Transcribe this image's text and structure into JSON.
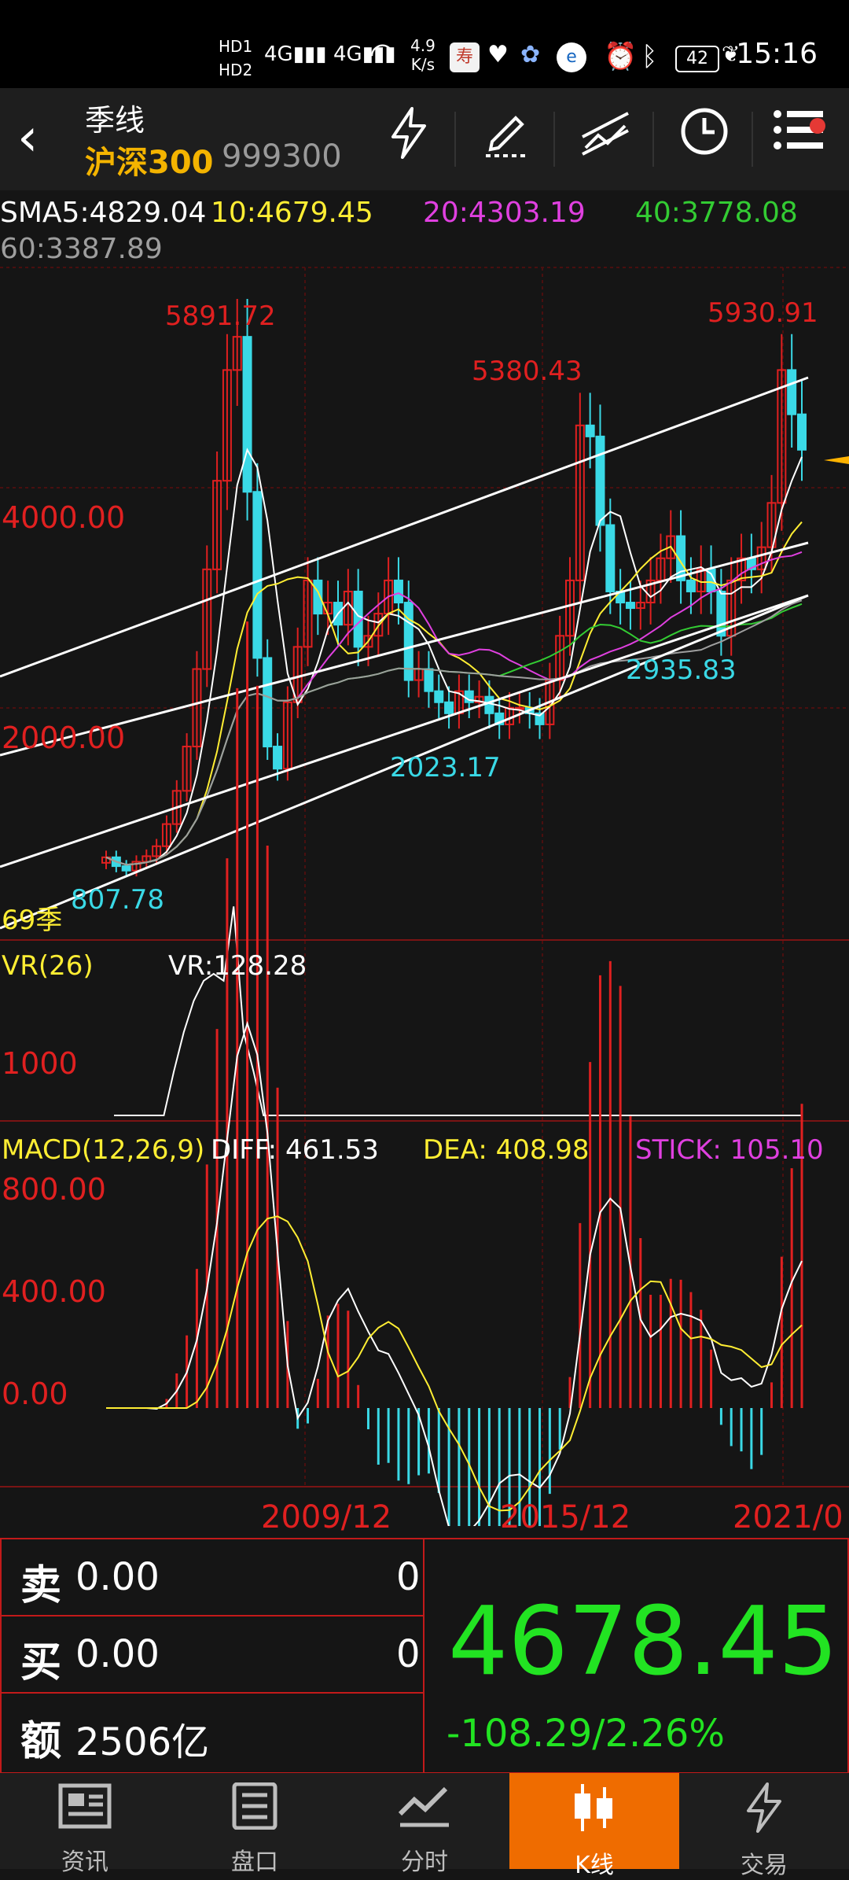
{
  "status_bar": {
    "time": "15:16",
    "battery": "42",
    "network_speed": "4.9",
    "network_unit": "K/s",
    "hd1": "HD1",
    "hd2": "HD2",
    "icons": [
      "signal-4g-icon",
      "signal-4g-icon",
      "wifi-icon",
      "app-icon",
      "heart-icon",
      "cloud-icon",
      "browser-icon",
      "alarm-icon",
      "bluetooth-icon",
      "battery-icon",
      "leaf-icon"
    ]
  },
  "header": {
    "title": "季线",
    "name": "沪深300",
    "code": "999300",
    "buttons": [
      "lightning-icon",
      "draw-icon",
      "trend-line-icon",
      "clock-icon",
      "menu-icon"
    ]
  },
  "ma_row": {
    "sma5": "SMA5:4829.04",
    "ma10": "10:4679.45",
    "ma20": "20:4303.19",
    "ma40": "40:3778.08",
    "ma60": "60:3387.89"
  },
  "colors": {
    "up": "#e02020",
    "down": "#3ad9e6",
    "ma5": "#ffffff",
    "ma10": "#ffee33",
    "ma20": "#e040e0",
    "ma40": "#33cc33",
    "ma60": "#9e9e9e",
    "accent": "#ef6c00",
    "price_green": "#22e322"
  },
  "main_chart": {
    "y_labels": [
      "4000.00",
      "2000.00"
    ],
    "high_label": "5930.91",
    "peak_2007_label": "5891.72",
    "peak_2015_label": "5380.43",
    "low_2005_label": "807.78",
    "low_2014_label": "2023.17",
    "low_2019_label": "2935.83",
    "count_label": "69季"
  },
  "vr_panel": {
    "name": "VR(26)",
    "value": "VR:128.28",
    "y_label": "1000"
  },
  "macd_panel": {
    "name": "MACD(12,26,9)",
    "diff": "DIFF: 461.53",
    "dea": "DEA: 408.98",
    "stick": "STICK: 105.10",
    "y_labels": [
      "800.00",
      "400.00",
      "0.00"
    ]
  },
  "x_axis": [
    "2009/12",
    "2015/12",
    "2021/0"
  ],
  "quote": {
    "sell_label": "卖",
    "sell_price": "0.00",
    "sell_qty": "0",
    "buy_label": "买",
    "buy_price": "0.00",
    "buy_qty": "0",
    "amount_label": "额",
    "amount": "2506亿",
    "last_price": "4678.45",
    "change": "-108.29/2.26%"
  },
  "nav": [
    {
      "label": "资讯",
      "icon": "news-icon"
    },
    {
      "label": "盘口",
      "icon": "orderbook-icon"
    },
    {
      "label": "分时",
      "icon": "timeshare-icon"
    },
    {
      "label": "K线",
      "icon": "kline-icon",
      "active": true
    },
    {
      "label": "交易",
      "icon": "trade-icon"
    }
  ]
}
